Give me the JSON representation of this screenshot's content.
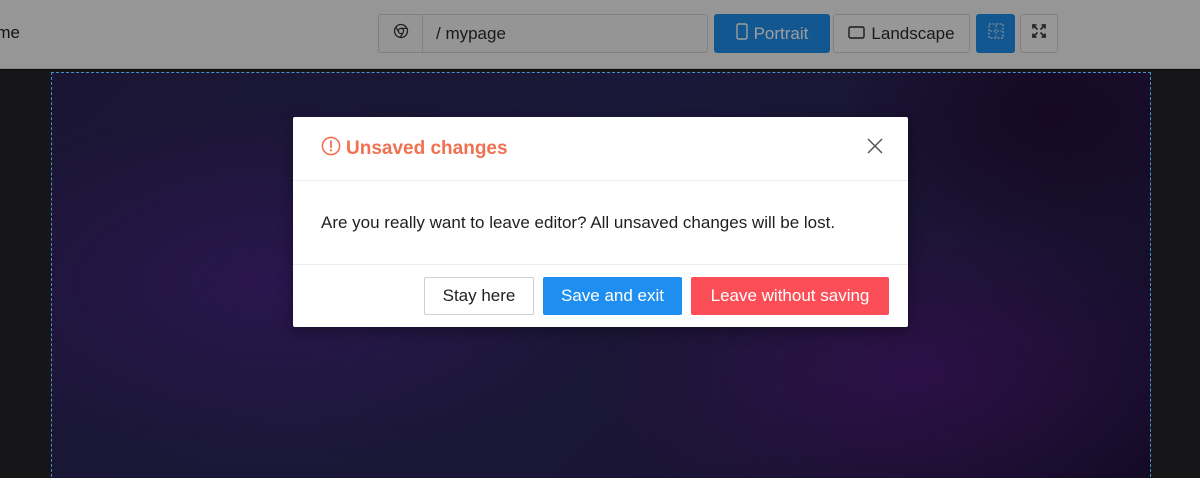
{
  "toolbar": {
    "app_name_fragment": "me",
    "url_text": "/ mypage",
    "url_icon": "chrome-icon",
    "portrait_label": "Portrait",
    "portrait_icon": "phone-portrait-icon",
    "landscape_label": "Landscape",
    "landscape_icon": "tablet-landscape-icon",
    "grid_icon": "grid-icon",
    "fullscreen_icon": "fullscreen-icon",
    "active_device": "Portrait"
  },
  "modal": {
    "title": "Unsaved changes",
    "title_icon": "warning-circle-icon",
    "message": "Are you really want to leave editor? All unsaved changes will be lost.",
    "close_icon": "close-icon",
    "buttons": {
      "stay": "Stay here",
      "save_exit": "Save and exit",
      "leave": "Leave without saving"
    }
  },
  "colors": {
    "accent_blue": "#1e8de8",
    "title_warning": "#f07152",
    "danger_red": "#fb4e57",
    "frame_border": "#4a90c8"
  }
}
